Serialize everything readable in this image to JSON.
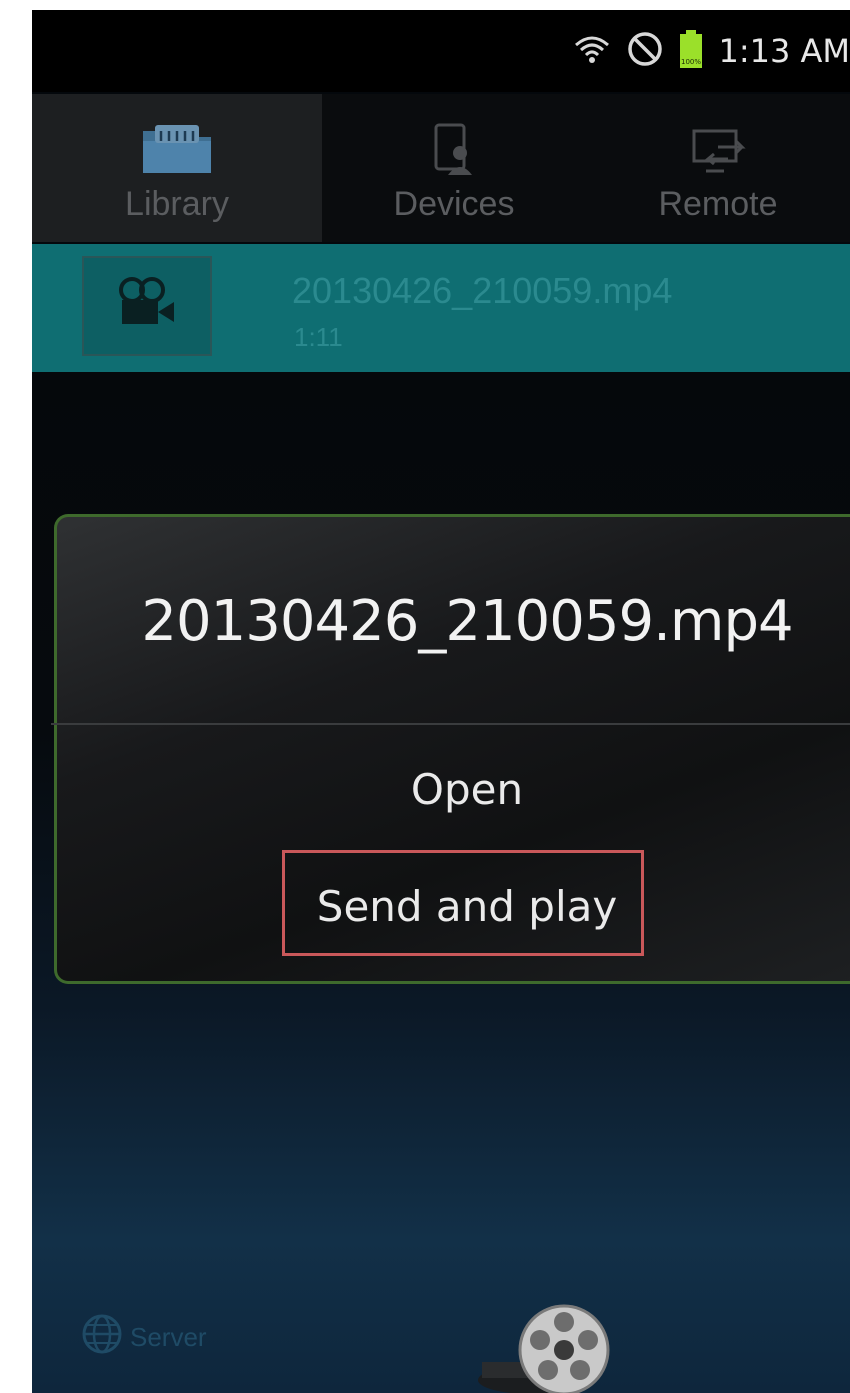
{
  "status_bar": {
    "time": "1:13 AM",
    "battery_text": "100%",
    "icons": [
      "wifi-icon",
      "blocked-icon",
      "battery-icon"
    ]
  },
  "tabs": [
    {
      "label": "Library",
      "icon": "folder-icon",
      "selected": true
    },
    {
      "label": "Devices",
      "icon": "device-person-icon",
      "selected": false
    },
    {
      "label": "Remote",
      "icon": "screen-arrows-icon",
      "selected": false
    }
  ],
  "list": {
    "items": [
      {
        "title": "20130426_210059.mp4",
        "duration": "1:11",
        "icon": "video-camera-icon"
      }
    ]
  },
  "dialog": {
    "title": "20130426_210059.mp4",
    "options": [
      "Open",
      "Send and play"
    ],
    "highlighted_option": "Send and play"
  },
  "bottom": {
    "server_label": "Server",
    "icon": "film-reel-icon"
  },
  "colors": {
    "accent_teal": "#0f6e72",
    "dialog_border": "#3e6a2c",
    "highlight": "#c9585a"
  }
}
